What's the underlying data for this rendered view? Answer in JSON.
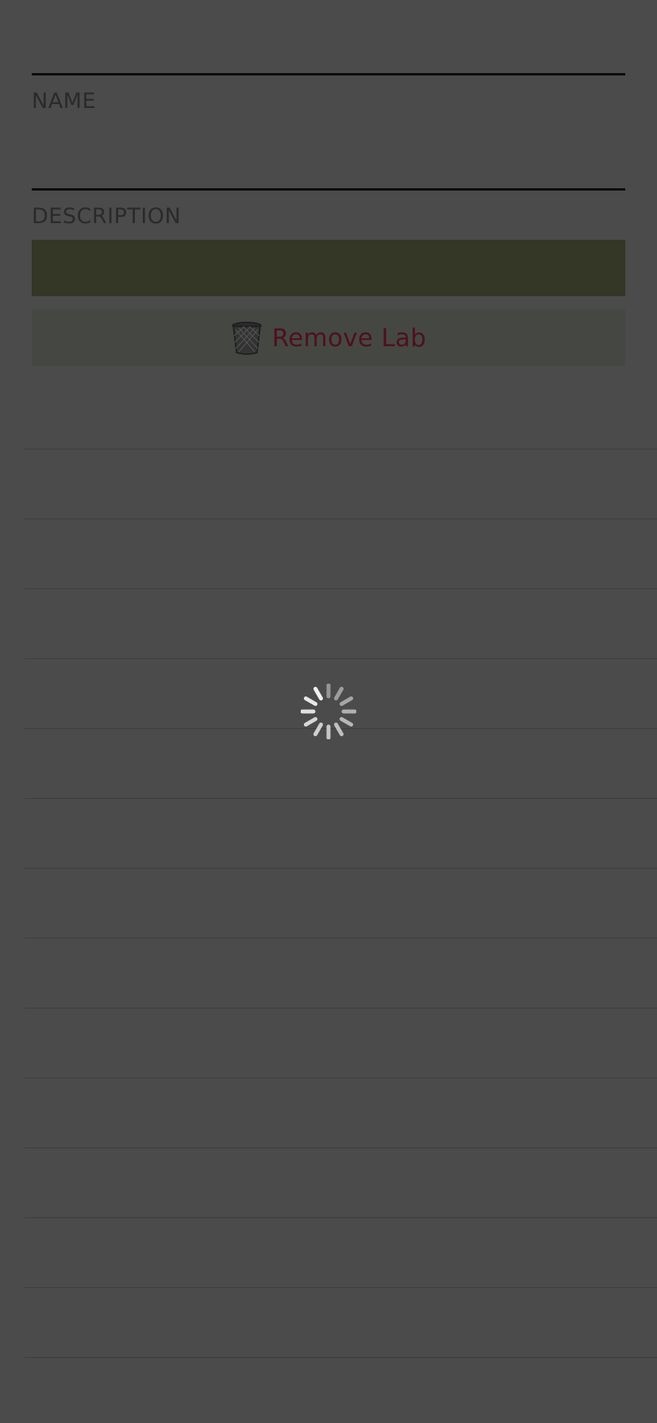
{
  "form": {
    "name_label": "NAME",
    "description_label": "DESCRIPTION",
    "name_value": "",
    "description_value": ""
  },
  "actions": {
    "remove_label": "Remove Lab",
    "remove_icon": "trash-icon"
  },
  "overlay": {
    "state": "loading",
    "spinner_icon": "activity-spinner-icon"
  },
  "list": {
    "row_count": 14
  },
  "colors": {
    "background": "#4b4b4b",
    "save_bar": "#343626",
    "remove_bar": "#454842",
    "remove_text": "#4e1020"
  }
}
